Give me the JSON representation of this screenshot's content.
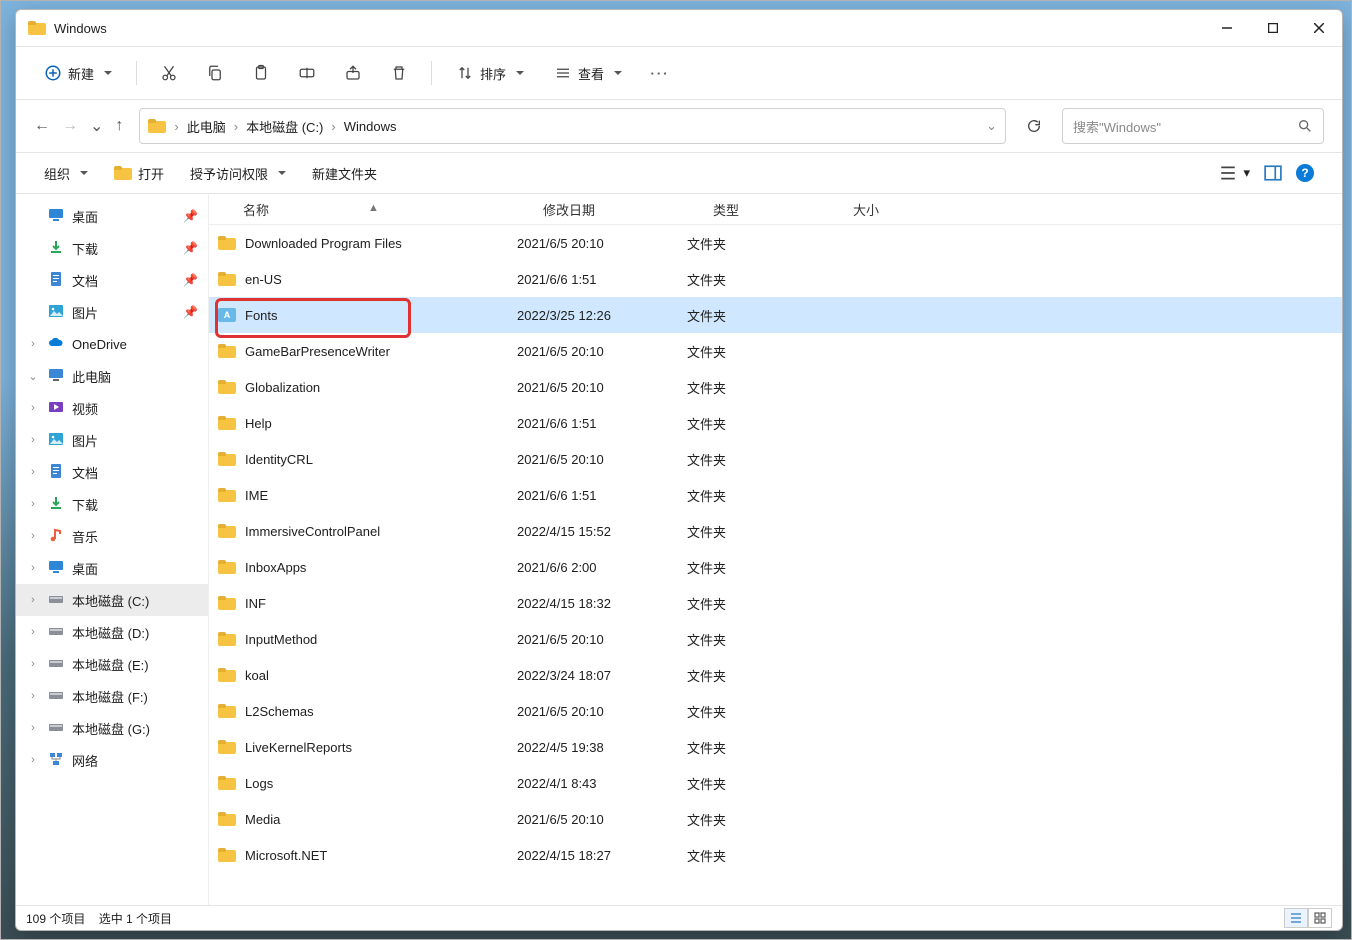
{
  "window": {
    "title": "Windows"
  },
  "cmdbar": {
    "new_label": "新建",
    "sort_label": "排序",
    "view_label": "查看"
  },
  "addr": {
    "crumbs": [
      "此电脑",
      "本地磁盘 (C:)",
      "Windows"
    ]
  },
  "search": {
    "placeholder": "搜索\"Windows\""
  },
  "toolbar2": {
    "organize": "组织",
    "open": "打开",
    "grant_access": "授予访问权限",
    "new_folder": "新建文件夹"
  },
  "columns": {
    "name": "名称",
    "date": "修改日期",
    "type": "类型",
    "size": "大小"
  },
  "nav": [
    {
      "label": "桌面",
      "icon": "desktop",
      "pinned": true,
      "indent": 1
    },
    {
      "label": "下载",
      "icon": "download",
      "pinned": true,
      "indent": 1
    },
    {
      "label": "文档",
      "icon": "doc",
      "pinned": true,
      "indent": 1
    },
    {
      "label": "图片",
      "icon": "picture",
      "pinned": true,
      "indent": 1
    },
    {
      "label": "OneDrive",
      "icon": "onedrive",
      "indent": 0,
      "tw": ">"
    },
    {
      "label": "此电脑",
      "icon": "pc",
      "indent": 0,
      "tw": "v"
    },
    {
      "label": "视频",
      "icon": "video",
      "indent": 1,
      "tw": ">"
    },
    {
      "label": "图片",
      "icon": "picture",
      "indent": 1,
      "tw": ">"
    },
    {
      "label": "文档",
      "icon": "doc",
      "indent": 1,
      "tw": ">"
    },
    {
      "label": "下载",
      "icon": "download",
      "indent": 1,
      "tw": ">"
    },
    {
      "label": "音乐",
      "icon": "music",
      "indent": 1,
      "tw": ">"
    },
    {
      "label": "桌面",
      "icon": "desktop",
      "indent": 1,
      "tw": ">"
    },
    {
      "label": "本地磁盘 (C:)",
      "icon": "disk",
      "indent": 1,
      "tw": ">",
      "sel": true
    },
    {
      "label": "本地磁盘 (D:)",
      "icon": "disk",
      "indent": 1,
      "tw": ">"
    },
    {
      "label": "本地磁盘 (E:)",
      "icon": "disk",
      "indent": 1,
      "tw": ">"
    },
    {
      "label": "本地磁盘 (F:)",
      "icon": "disk",
      "indent": 1,
      "tw": ">"
    },
    {
      "label": "本地磁盘 (G:)",
      "icon": "disk",
      "indent": 1,
      "tw": ">"
    },
    {
      "label": "网络",
      "icon": "network",
      "indent": 0,
      "tw": ">"
    }
  ],
  "files": [
    {
      "name": "Downloaded Program Files",
      "date": "2021/6/5 20:10",
      "type": "文件夹",
      "icon": "folder"
    },
    {
      "name": "en-US",
      "date": "2021/6/6 1:51",
      "type": "文件夹",
      "icon": "folder"
    },
    {
      "name": "Fonts",
      "date": "2022/3/25 12:26",
      "type": "文件夹",
      "icon": "fonts",
      "selected": true,
      "highlight": true
    },
    {
      "name": "GameBarPresenceWriter",
      "date": "2021/6/5 20:10",
      "type": "文件夹",
      "icon": "folder"
    },
    {
      "name": "Globalization",
      "date": "2021/6/5 20:10",
      "type": "文件夹",
      "icon": "folder"
    },
    {
      "name": "Help",
      "date": "2021/6/6 1:51",
      "type": "文件夹",
      "icon": "folder"
    },
    {
      "name": "IdentityCRL",
      "date": "2021/6/5 20:10",
      "type": "文件夹",
      "icon": "folder"
    },
    {
      "name": "IME",
      "date": "2021/6/6 1:51",
      "type": "文件夹",
      "icon": "folder"
    },
    {
      "name": "ImmersiveControlPanel",
      "date": "2022/4/15 15:52",
      "type": "文件夹",
      "icon": "folder"
    },
    {
      "name": "InboxApps",
      "date": "2021/6/6 2:00",
      "type": "文件夹",
      "icon": "folder"
    },
    {
      "name": "INF",
      "date": "2022/4/15 18:32",
      "type": "文件夹",
      "icon": "folder"
    },
    {
      "name": "InputMethod",
      "date": "2021/6/5 20:10",
      "type": "文件夹",
      "icon": "folder"
    },
    {
      "name": "koal",
      "date": "2022/3/24 18:07",
      "type": "文件夹",
      "icon": "folder"
    },
    {
      "name": "L2Schemas",
      "date": "2021/6/5 20:10",
      "type": "文件夹",
      "icon": "folder"
    },
    {
      "name": "LiveKernelReports",
      "date": "2022/4/5 19:38",
      "type": "文件夹",
      "icon": "folder"
    },
    {
      "name": "Logs",
      "date": "2022/4/1 8:43",
      "type": "文件夹",
      "icon": "folder"
    },
    {
      "name": "Media",
      "date": "2021/6/5 20:10",
      "type": "文件夹",
      "icon": "folder"
    },
    {
      "name": "Microsoft.NET",
      "date": "2022/4/15 18:27",
      "type": "文件夹",
      "icon": "folder"
    }
  ],
  "status": {
    "count": "109 个项目",
    "selected": "选中 1 个项目"
  }
}
